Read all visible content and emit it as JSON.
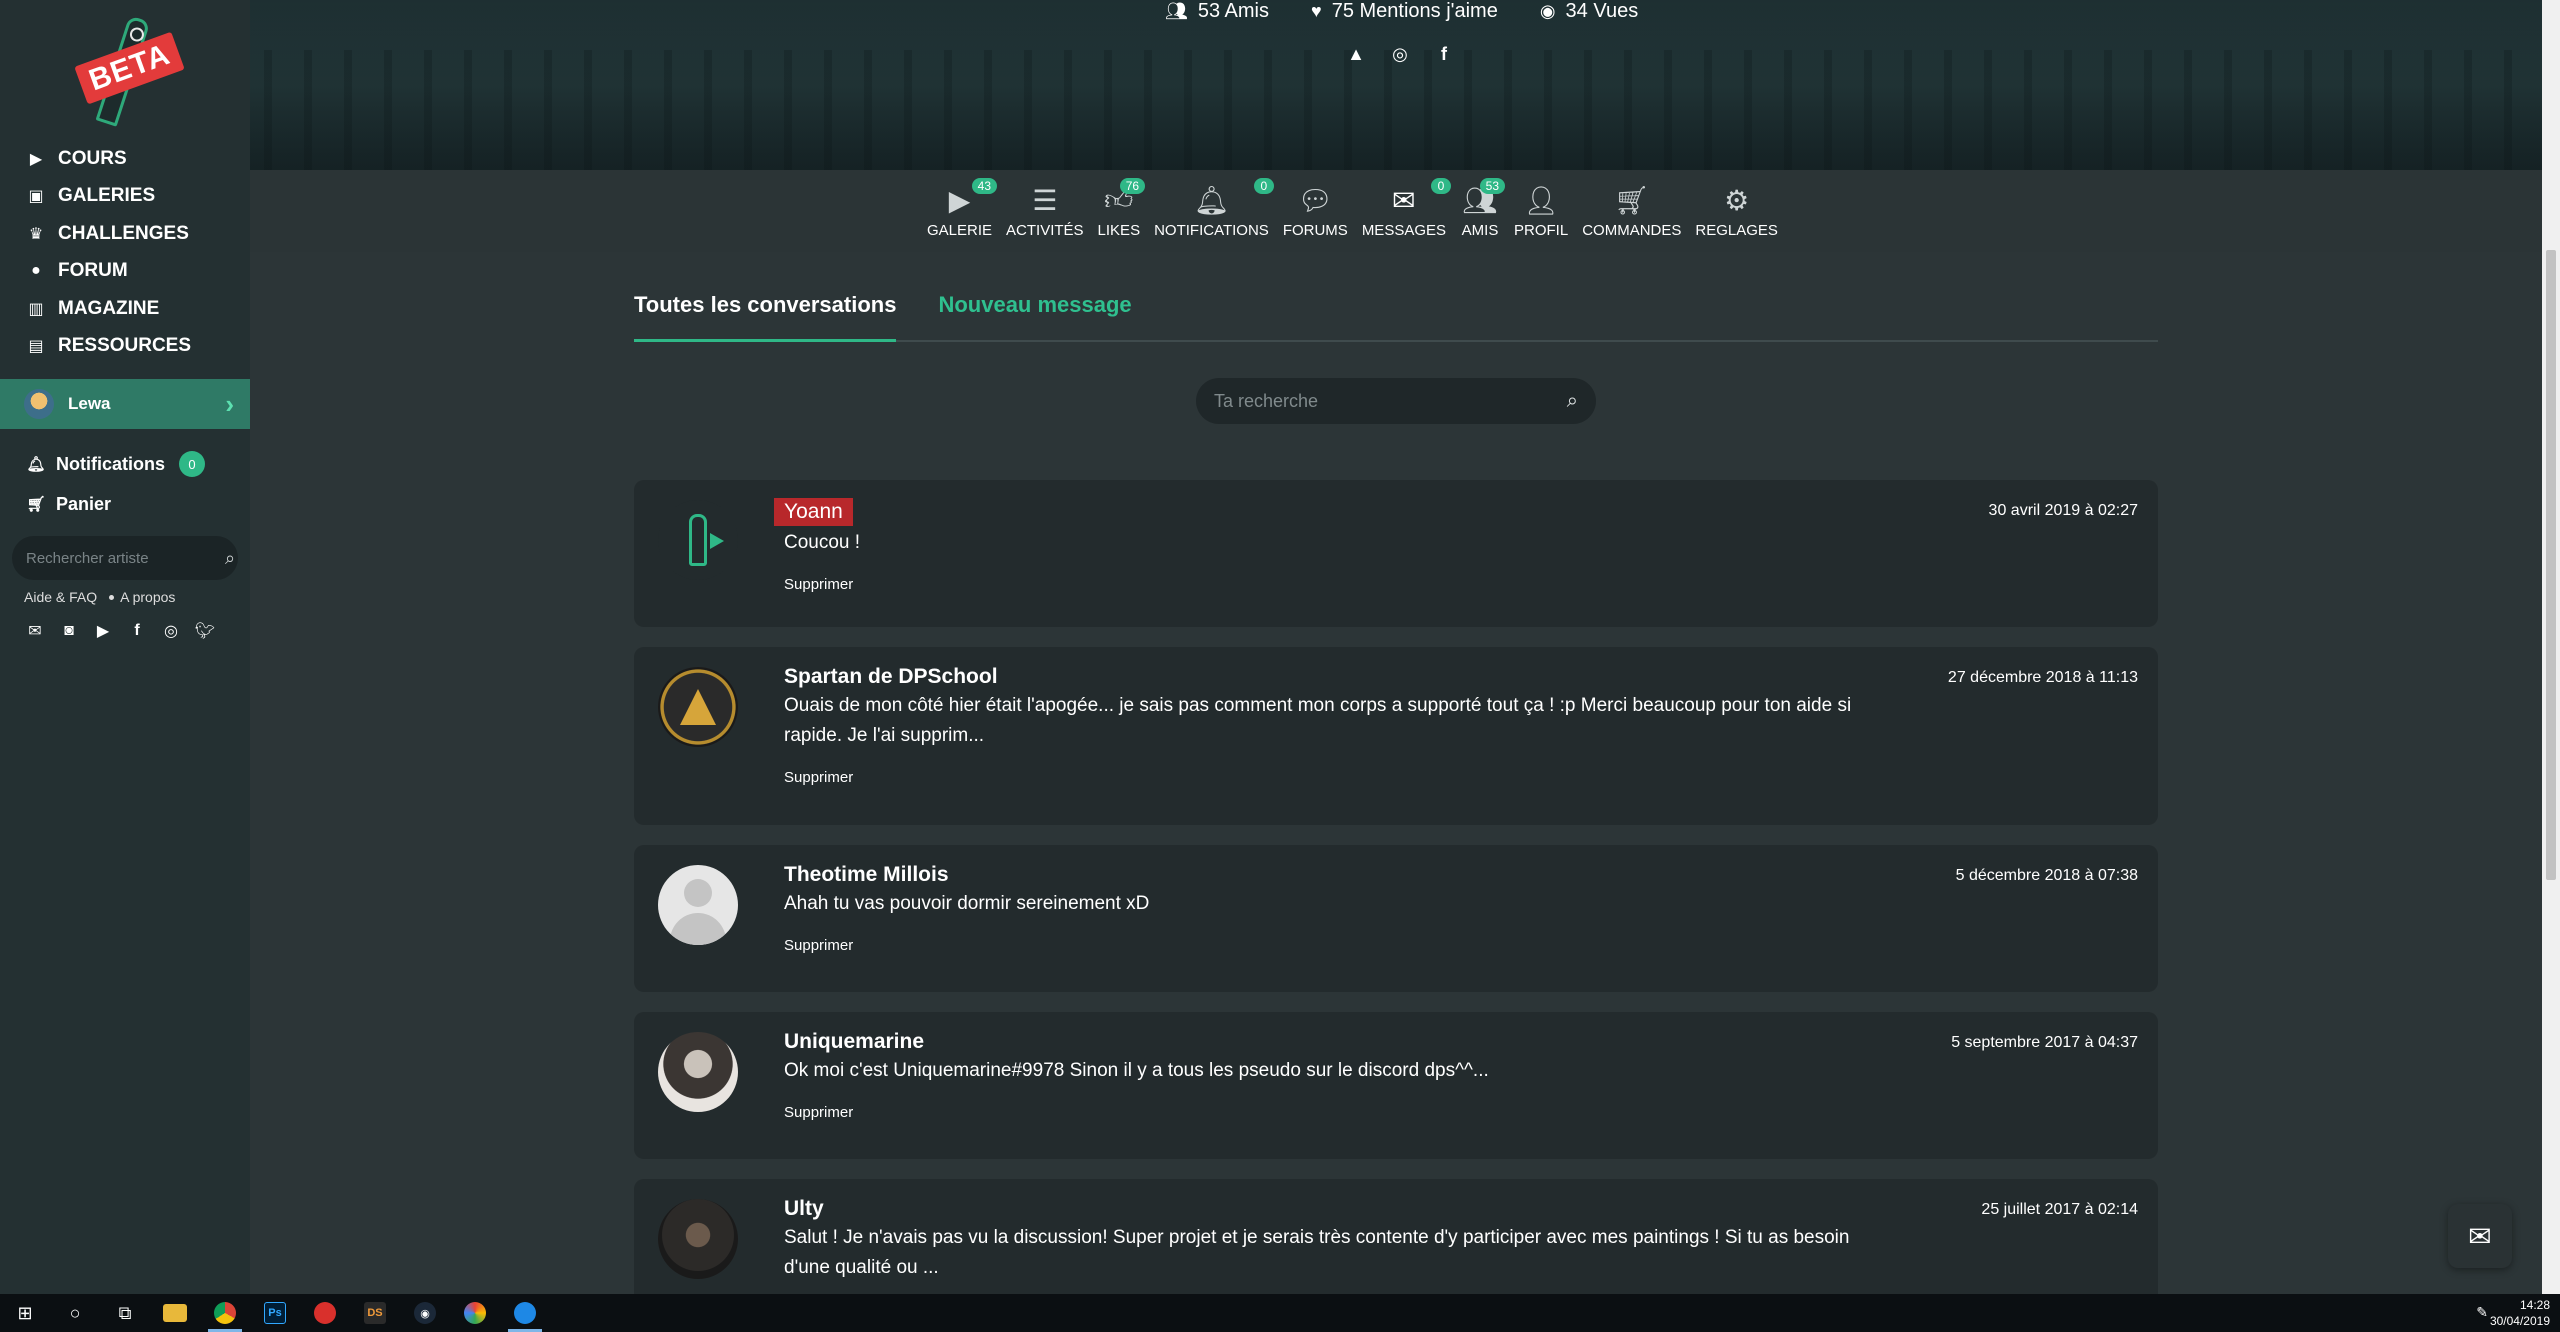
{
  "sidebar": {
    "logo_text": "BETA",
    "nav": [
      {
        "label": "COURS",
        "icon": "play-icon"
      },
      {
        "label": "GALERIES",
        "icon": "images-icon"
      },
      {
        "label": "CHALLENGES",
        "icon": "trophy-icon"
      },
      {
        "label": "FORUM",
        "icon": "comments-icon"
      },
      {
        "label": "MAGAZINE",
        "icon": "book-open-icon"
      },
      {
        "label": "RESSOURCES",
        "icon": "book-icon"
      }
    ],
    "user": {
      "name": "Lewa"
    },
    "notifications": {
      "label": "Notifications",
      "count": "0"
    },
    "cart": {
      "label": "Panier"
    },
    "search_placeholder": "Rechercher artiste",
    "footer_links": [
      "Aide & FAQ",
      "A propos"
    ],
    "social_icons": [
      "mail-icon",
      "discord-icon",
      "youtube-icon",
      "facebook-icon",
      "instagram-icon",
      "twitter-icon"
    ]
  },
  "banner": {
    "stats": [
      {
        "icon": "users-icon",
        "text": "53 Amis"
      },
      {
        "icon": "heart-icon",
        "text": "75 Mentions j'aime"
      },
      {
        "icon": "eye-icon",
        "text": "34 Vues"
      }
    ],
    "social_icons": [
      "artstation-icon",
      "instagram-icon",
      "facebook-icon"
    ]
  },
  "tabs": [
    {
      "label": "GALERIE",
      "icon": "play-icon",
      "count": "43"
    },
    {
      "label": "ACTIVITÉS",
      "icon": "list-icon",
      "count": ""
    },
    {
      "label": "LIKES",
      "icon": "thumbs-up-icon",
      "count": "76"
    },
    {
      "label": "NOTIFICATIONS",
      "icon": "bell-icon",
      "count": "0"
    },
    {
      "label": "FORUMS",
      "icon": "comments-icon",
      "count": ""
    },
    {
      "label": "MESSAGES",
      "icon": "envelope-icon",
      "count": "0"
    },
    {
      "label": "AMIS",
      "icon": "user-friends-icon",
      "count": "53"
    },
    {
      "label": "PROFIL",
      "icon": "user-icon",
      "count": ""
    },
    {
      "label": "COMMANDES",
      "icon": "cart-icon",
      "count": ""
    },
    {
      "label": "REGLAGES",
      "icon": "gear-icon",
      "count": ""
    }
  ],
  "messages": {
    "subtabs": [
      "Toutes les conversations",
      "Nouveau message"
    ],
    "search_placeholder": "Ta recherche",
    "delete_label": "Supprimer",
    "conversations": [
      {
        "name": "Yoann",
        "unread": true,
        "date": "30 avril 2019 à 02:27",
        "text": "Coucou !"
      },
      {
        "name": "Spartan de DPSchool",
        "unread": false,
        "date": "27 décembre 2018 à 11:13",
        "text": "Ouais de mon côté hier était l'apogée... je sais pas comment mon corps a supporté tout ça ! :p Merci beaucoup pour ton aide si rapide. Je l'ai supprim..."
      },
      {
        "name": "Theotime Millois",
        "unread": false,
        "date": "5 décembre 2018 à 07:38",
        "text": "Ahah tu vas pouvoir dormir sereinement xD"
      },
      {
        "name": "Uniquemarine",
        "unread": false,
        "date": "5 septembre 2017 à 04:37",
        "text": "Ok moi c'est Uniquemarine#9978 Sinon il y a tous les pseudo sur le discord dps^^..."
      },
      {
        "name": "Ulty",
        "unread": false,
        "date": "25 juillet 2017 à 02:14",
        "text": "Salut ! Je n'avais pas vu la discussion! Super projet et je serais très contente d'y participer avec mes paintings ! Si tu as besoin d'une qualité ou ..."
      }
    ]
  },
  "taskbar": {
    "apps": [
      "windows-start-icon",
      "search-circle-icon",
      "task-view-icon",
      "file-explorer-icon",
      "chrome-icon",
      "photoshop-icon",
      "app-red-icon",
      "daz-studio-icon",
      "steam-icon",
      "app-multicolor-icon",
      "app-blue-icon"
    ],
    "photoshop_label": "Ps",
    "daz_label": "DS",
    "time": "14:28",
    "date": "30/04/2019"
  },
  "colors": {
    "accent": "#2fb887",
    "unread_red": "#b8282b",
    "sidebar_bg": "#243032",
    "main_bg": "#2c3537",
    "card_bg": "#232b2d"
  }
}
